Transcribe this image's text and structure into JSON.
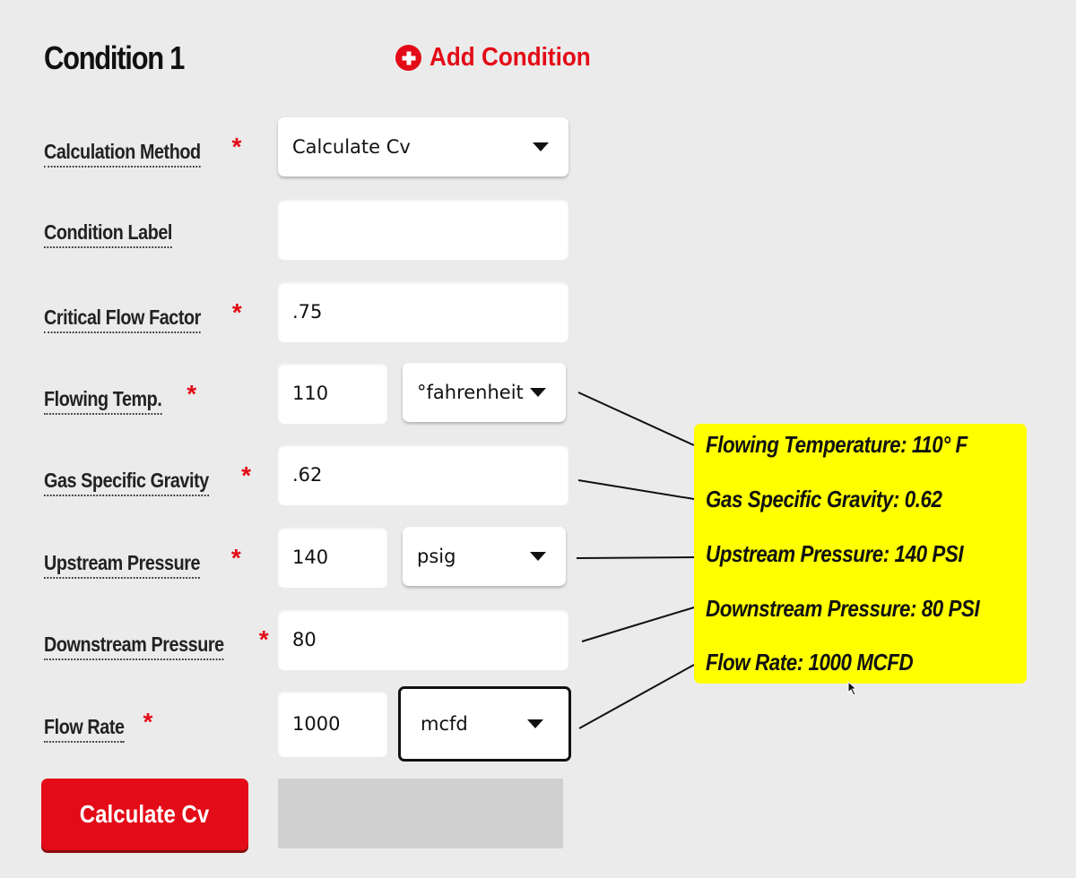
{
  "header": {
    "title": "Condition 1",
    "add_condition_label": "Add Condition"
  },
  "form": {
    "calculation_method": {
      "label": "Calculation Method",
      "required": "*",
      "value": "Calculate Cv"
    },
    "condition_label": {
      "label": "Condition Label",
      "value": ""
    },
    "critical_flow_factor": {
      "label": "Critical Flow Factor",
      "required": "*",
      "value": ".75"
    },
    "flowing_temp": {
      "label": "Flowing Temp.",
      "required": "*",
      "value": "110",
      "unit": "°fahrenheit"
    },
    "gas_specific_gravity": {
      "label": "Gas Specific Gravity",
      "required": "*",
      "value": ".62"
    },
    "upstream_pressure": {
      "label": "Upstream Pressure",
      "required": "*",
      "value": "140",
      "unit": "psig"
    },
    "downstream_pressure": {
      "label": "Downstream Pressure",
      "required": "*",
      "value": "80"
    },
    "flow_rate": {
      "label": "Flow Rate",
      "required": "*",
      "value": "1000",
      "unit": "mcfd"
    }
  },
  "actions": {
    "calculate_label": "Calculate Cv",
    "result": ""
  },
  "annotation": {
    "color": "#ffff00",
    "lines": [
      "Flowing Temperature: 110° F",
      "Gas Specific Gravity: 0.62",
      "Upstream Pressure: 140 PSI",
      "Downstream Pressure: 80 PSI",
      "Flow Rate: 1000 MCFD"
    ]
  },
  "colors": {
    "accent": "#e30b17",
    "background": "#ebebeb",
    "result_box": "#d0d0d0"
  }
}
